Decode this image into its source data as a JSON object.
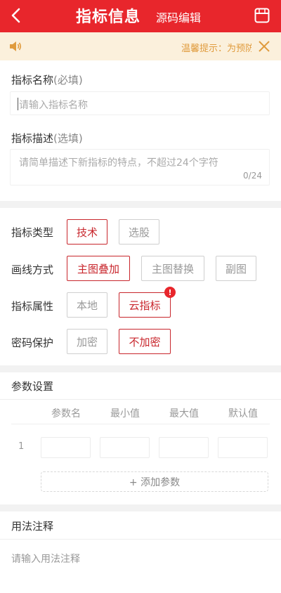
{
  "header": {
    "title": "指标信息",
    "source_edit": "源码编辑",
    "back_icon": "chevron-left-icon",
    "save_icon": "save-icon",
    "background": "#e8262c"
  },
  "notice": {
    "text": "温馨提示：为预防",
    "speaker_icon": "speaker-icon",
    "close_icon": "close-icon",
    "text_color": "#e09b3d"
  },
  "name_field": {
    "label": "指标名称",
    "hint": "(必填)",
    "placeholder": "请输入指标名称"
  },
  "desc_field": {
    "label": "指标描述",
    "hint": "(选填)",
    "placeholder": "请简单描述下新指标的特点，不超过24个字符",
    "counter": "0/24"
  },
  "options": {
    "type": {
      "label": "指标类型",
      "items": [
        "技术",
        "选股"
      ],
      "selected": "技术"
    },
    "draw": {
      "label": "画线方式",
      "items": [
        "主图叠加",
        "主图替换",
        "副图"
      ],
      "selected": "主图叠加"
    },
    "attr": {
      "label": "指标属性",
      "items": [
        "本地",
        "云指标"
      ],
      "selected": "云指标",
      "badge": "!"
    },
    "password": {
      "label": "密码保护",
      "items": [
        "加密",
        "不加密"
      ],
      "selected": "不加密"
    }
  },
  "params": {
    "title": "参数设置",
    "columns": [
      "参数名",
      "最小值",
      "最大值",
      "默认值"
    ],
    "rows": [
      {
        "index": "1"
      }
    ],
    "add_label": "+ 添加参数"
  },
  "usage": {
    "title": "用法注释",
    "placeholder": "请输入用法注释"
  },
  "accent_color": "#c8262c"
}
